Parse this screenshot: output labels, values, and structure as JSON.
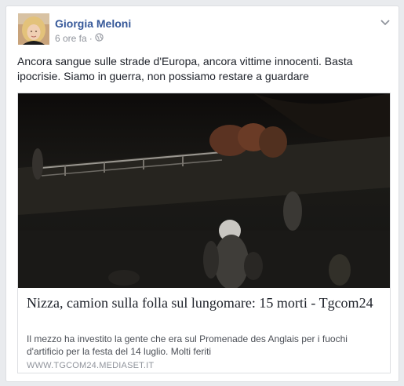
{
  "post": {
    "author": "Giorgia Meloni",
    "time": "6 ore fa",
    "separator": "·",
    "privacy_icon": "globe-icon",
    "menu_icon": "chevron-down-icon",
    "text": "Ancora sangue sulle strade d'Europa, ancora vittime innocenti. Basta ipocrisie. Siamo in guerra, non possiamo restare a guardare"
  },
  "link_preview": {
    "title": "Nizza, camion sulla folla sul lungomare: 15 morti - Tgcom24",
    "description": "Il mezzo ha investito la gente che era sul Promenade des Anglais per i fuochi d'artificio per la festa del 14 luglio. Molti feriti",
    "domain": "WWW.TGCOM24.MEDIASET.IT"
  },
  "colors": {
    "author_link": "#365899",
    "meta_text": "#90949c",
    "body_text": "#1d2129",
    "page_bg": "#e9ebee"
  }
}
